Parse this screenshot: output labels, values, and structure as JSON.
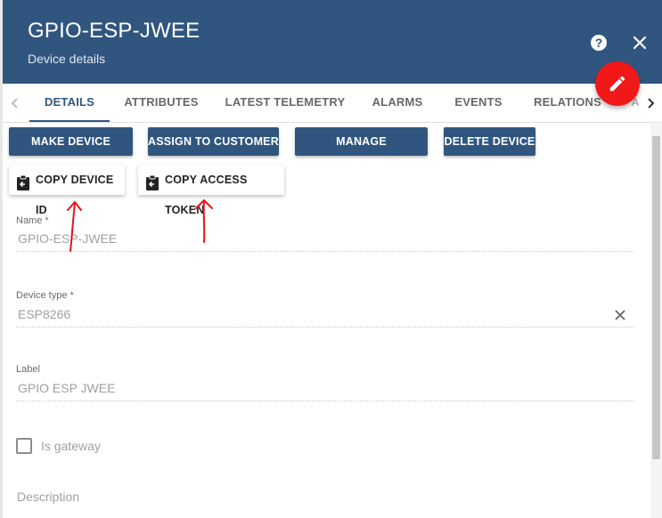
{
  "header": {
    "title": "GPIO-ESP-JWEE",
    "subtitle": "Device details",
    "help_icon": "help-circle-icon",
    "close_icon": "close-icon",
    "edit_icon": "pencil-icon",
    "bg_color": "#305680",
    "fab_color": "#f01818"
  },
  "tabs": [
    {
      "label": "DETAILS",
      "active": true
    },
    {
      "label": "ATTRIBUTES"
    },
    {
      "label": "LATEST TELEMETRY"
    },
    {
      "label": "ALARMS"
    },
    {
      "label": "EVENTS"
    },
    {
      "label": "RELATIONS"
    },
    {
      "label": "A"
    }
  ],
  "actions": {
    "make_public": "MAKE DEVICE PUBLIC",
    "assign_customer": "ASSIGN TO CUSTOMER",
    "manage_credentials": "MANAGE CREDENTIALS",
    "delete_device": "DELETE DEVICE",
    "copy_device_id": "COPY DEVICE ID",
    "copy_access_token": "COPY ACCESS TOKEN"
  },
  "form": {
    "name_label": "Name *",
    "name_value": "GPIO-ESP-JWEE",
    "type_label": "Device type *",
    "type_value": "ESP8266",
    "label_label": "Label",
    "label_value": "GPIO ESP JWEE",
    "gateway_label": "Is gateway",
    "gateway_checked": false,
    "description_label": "Description"
  },
  "annotation_color": "#e8141a"
}
